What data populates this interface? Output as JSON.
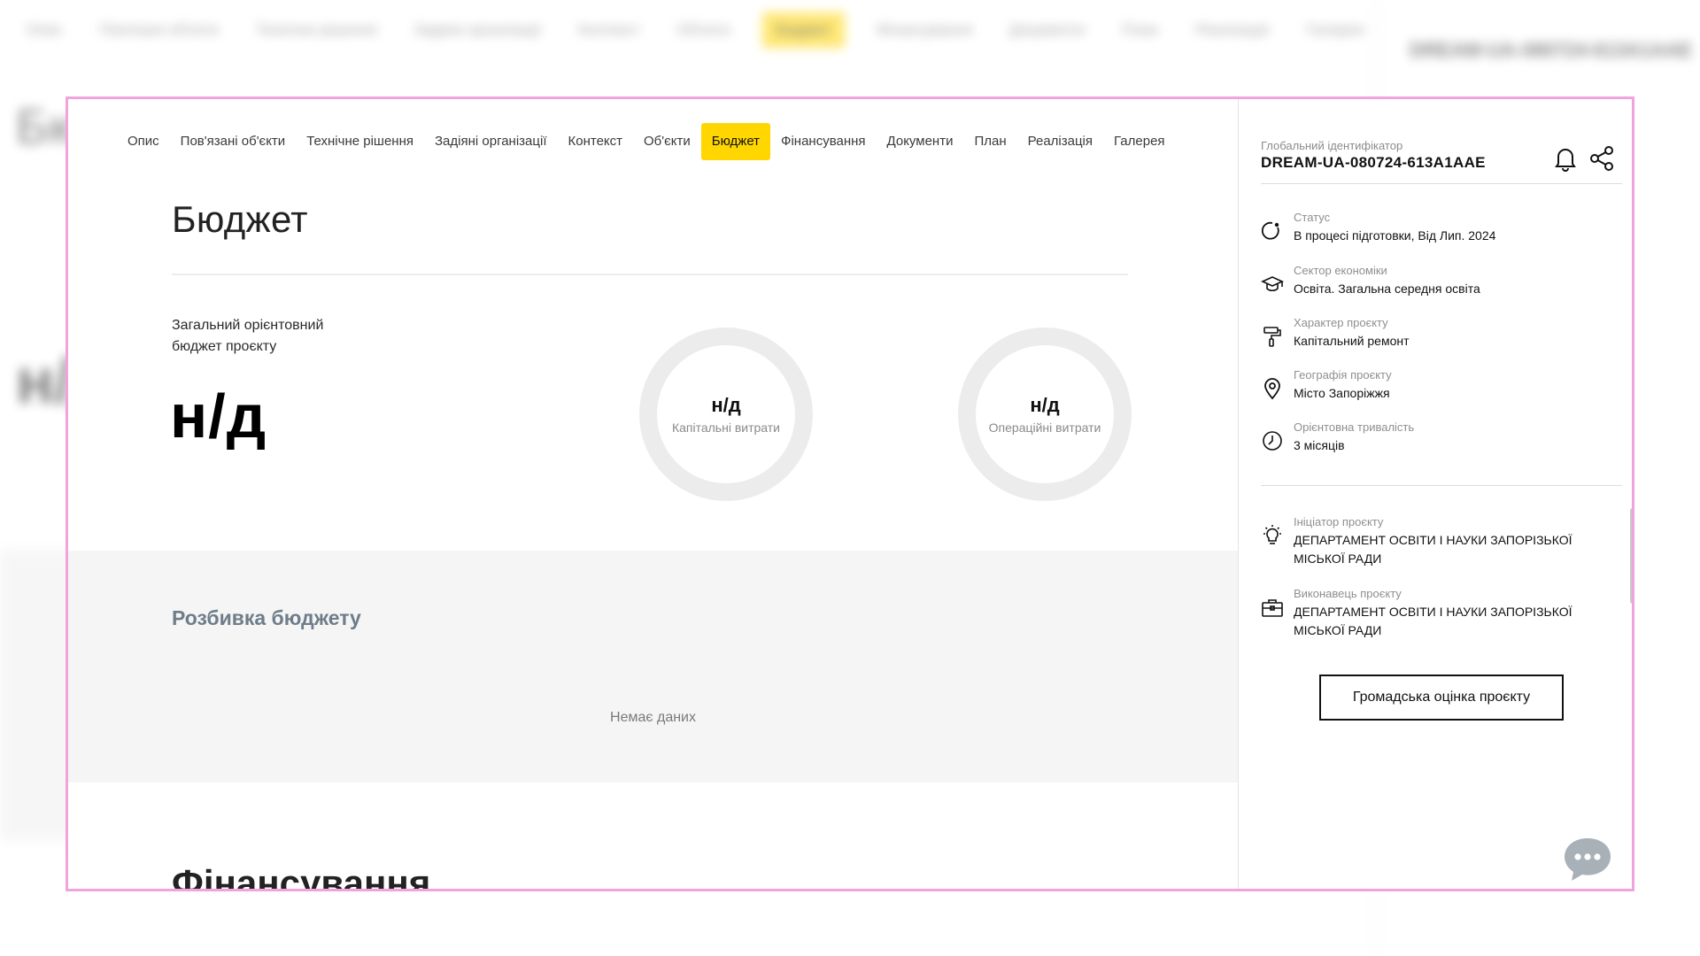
{
  "nav": {
    "tabs": [
      {
        "label": "Опис"
      },
      {
        "label": "Пов'язані об'єкти"
      },
      {
        "label": "Технічне рішення"
      },
      {
        "label": "Задіяні організації"
      },
      {
        "label": "Контекст"
      },
      {
        "label": "Об'єкти"
      },
      {
        "label": "Бюджет",
        "active": true
      },
      {
        "label": "Фінансування"
      },
      {
        "label": "Документи"
      },
      {
        "label": "План"
      },
      {
        "label": "Реалізація"
      },
      {
        "label": "Галерея"
      }
    ]
  },
  "main": {
    "title": "Бюджет",
    "budget_label": "Загальний орієнтовний бюджет проєкту",
    "budget_value": "н/д",
    "capital": {
      "value": "н/д",
      "label": "Капітальні витрати"
    },
    "operational": {
      "value": "н/д",
      "label": "Операційні витрати"
    },
    "breakdown_title": "Розбивка бюджету",
    "no_data": "Немає даних",
    "financing_title": "Фінансування"
  },
  "sidebar": {
    "global_id_label": "Глобальний ідентифікатор",
    "global_id": "DREAM-UA-080724-613A1AAE",
    "info": [
      {
        "label": "Статус",
        "value": "В процесі підготовки, Від Лип. 2024",
        "icon": "status-icon"
      },
      {
        "label": "Сектор економіки",
        "value": "Освіта. Загальна середня освіта",
        "icon": "graduation-cap-icon"
      },
      {
        "label": "Характер проєкту",
        "value": "Капітальний ремонт",
        "icon": "paint-roller-icon"
      },
      {
        "label": "Географія проєкту",
        "value": "Місто Запоріжжя",
        "icon": "location-pin-icon"
      },
      {
        "label": "Орієнтовна тривалість",
        "value": "3 місяців",
        "icon": "clock-icon"
      }
    ],
    "initiator": {
      "label": "Ініціатор проєкту",
      "value": "ДЕПАРТАМЕНТ ОСВІТИ І НАУКИ ЗАПОРІЗЬКОЇ МІСЬКОЇ РАДИ"
    },
    "executor": {
      "label": "Виконавець проєкту",
      "value": "ДЕПАРТАМЕНТ ОСВІТИ І НАУКИ ЗАПОРІЗЬКОЇ МІСЬКОЇ РАДИ"
    },
    "evaluation_button": "Громадська оцінка проєкту"
  },
  "colors": {
    "accent": "#ffd600",
    "frame_border": "#f0a3dc",
    "breakdown_bg": "#f5f5f5",
    "breakdown_title": "#6f7d8a"
  }
}
